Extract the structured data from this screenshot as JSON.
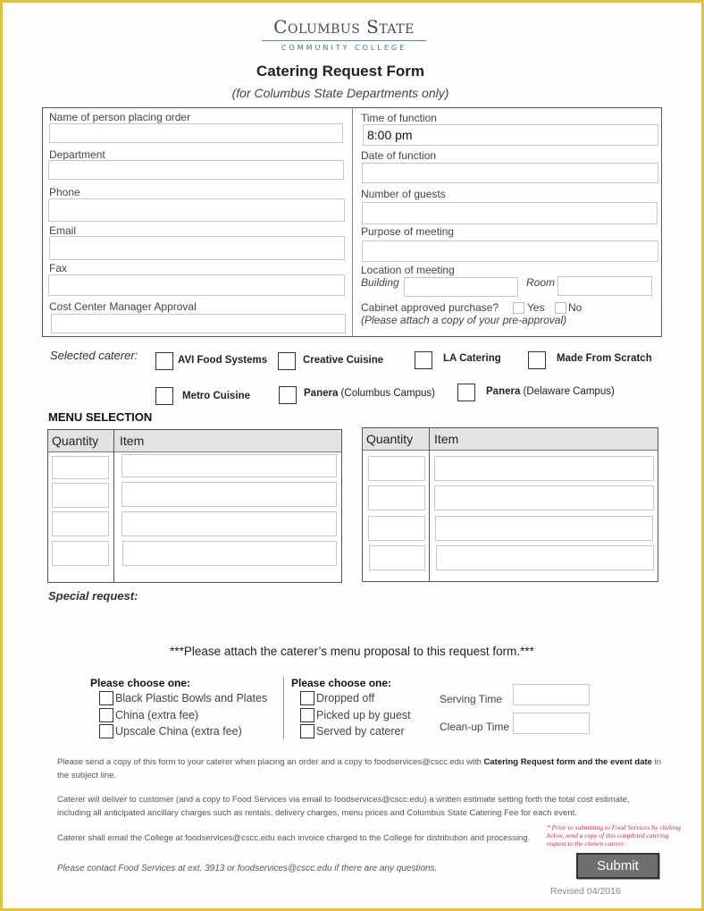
{
  "header": {
    "logo_main": "Columbus State",
    "logo_sub": "COMMUNITY COLLEGE",
    "title": "Catering Request Form",
    "subtitle": "(for Columbus State Departments only)"
  },
  "left_fields": [
    {
      "label": "Name of person placing order",
      "value": ""
    },
    {
      "label": "Department",
      "value": ""
    },
    {
      "label": "Phone",
      "value": ""
    },
    {
      "label": "Email",
      "value": ""
    },
    {
      "label": "Fax",
      "value": ""
    },
    {
      "label": "Cost Center Manager Approval",
      "value": ""
    }
  ],
  "right_fields": [
    {
      "label": "Time of function",
      "value": "8:00 pm"
    },
    {
      "label": "Date of function",
      "value": ""
    },
    {
      "label": "Number of guests",
      "value": ""
    },
    {
      "label": "Purpose of meeting",
      "value": ""
    }
  ],
  "location": {
    "label": "Location of meeting",
    "building_label": "Building",
    "building_value": "",
    "room_label": "Room",
    "room_value": ""
  },
  "cabinet": {
    "label": "Cabinet approved purchase?",
    "yes_label": "Yes",
    "no_label": "No",
    "yes_checked": false,
    "no_checked": false,
    "note": "(Please attach a copy of your pre-approval)"
  },
  "caterers": {
    "label": "Selected caterer:",
    "options": [
      {
        "name": "AVI Food Systems",
        "detail": "",
        "checked": false
      },
      {
        "name": "Creative Cuisine",
        "detail": "",
        "checked": false
      },
      {
        "name": "LA Catering",
        "detail": "",
        "checked": false
      },
      {
        "name": "Made From Scratch",
        "detail": "",
        "checked": false
      },
      {
        "name": "Metro Cuisine",
        "detail": "",
        "checked": false
      },
      {
        "name": "Panera",
        "detail": " (Columbus Campus)",
        "checked": false
      },
      {
        "name": "Panera",
        "detail": " (Delaware Campus)",
        "checked": false
      }
    ]
  },
  "menu": {
    "title": "MENU SELECTION",
    "col_quantity": "Quantity",
    "col_item": "Item",
    "left_rows": [
      {
        "quantity": "",
        "item": ""
      },
      {
        "quantity": "",
        "item": ""
      },
      {
        "quantity": "",
        "item": ""
      },
      {
        "quantity": "",
        "item": ""
      }
    ],
    "right_rows": [
      {
        "quantity": "",
        "item": ""
      },
      {
        "quantity": "",
        "item": ""
      },
      {
        "quantity": "",
        "item": ""
      },
      {
        "quantity": "",
        "item": ""
      }
    ]
  },
  "special_request_label": "Special request:",
  "attach_note": "***Please attach the caterer’s menu proposal to this request form.***",
  "dishware": {
    "heading": "Please choose one:",
    "options": [
      {
        "label": "Black Plastic Bowls and Plates",
        "checked": false
      },
      {
        "label": "China (extra fee)",
        "checked": false
      },
      {
        "label": "Upscale China (extra fee)",
        "checked": false
      }
    ]
  },
  "service": {
    "heading": "Please choose one:",
    "options": [
      {
        "label": "Dropped off",
        "checked": false
      },
      {
        "label": "Picked up by guest",
        "checked": false
      },
      {
        "label": "Served by caterer",
        "checked": false
      }
    ]
  },
  "times": {
    "serving_label": "Serving Time",
    "serving_value": "",
    "cleanup_label": "Clean-up Time",
    "cleanup_value": ""
  },
  "instructions": {
    "p1_text": "Please send a copy of this form to your caterer when placing an order and a copy to foodservices@cscc.edu with ",
    "p1_bold": "Catering Request form and the event date",
    "p1_end": " in the subject line.",
    "p2": "Caterer will deliver to customer (and a copy to Food Services via email to foodservices@cscc.edu) a written estimate setting forth the total cost estimate, including all anticipated ancillary charges such as rentals, delivery charges, menu prices and Columbus State Catering Fee for each event.",
    "p3": "Caterer shall email the College at foodservices@cscc.edu each invoice charged to the College for distribution and processing.",
    "p4": "Please contact Food Services at ext. 3913 or foodservices@cscc.edu if there are any questions."
  },
  "submit_note": "* Prior to submitting to Food Services by clicking below, send a copy of this completed catering request to the chosen caterer.",
  "submit_label": "Submit",
  "revised": "Revised 04/2016"
}
